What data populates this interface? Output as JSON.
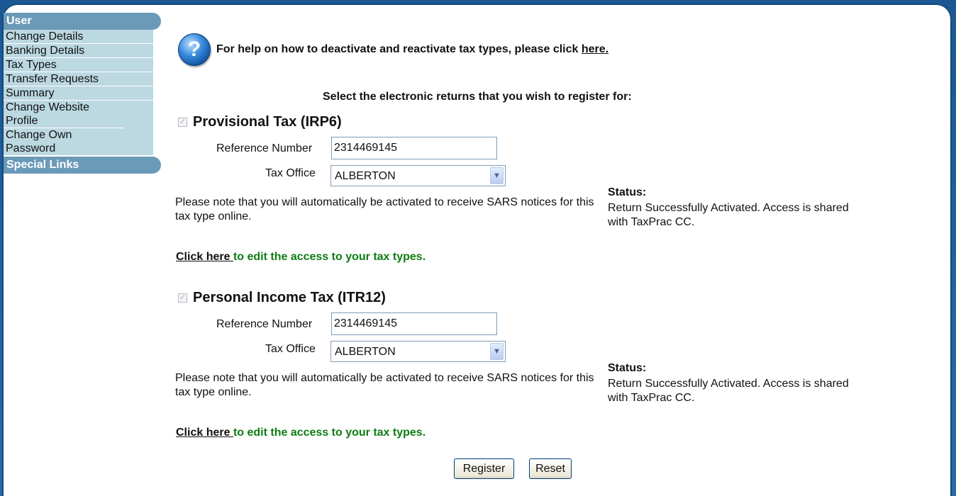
{
  "sidebar": {
    "user_heading": "User",
    "items": [
      {
        "label": "Change Details"
      },
      {
        "label": "Banking Details"
      },
      {
        "label": "Tax Types"
      },
      {
        "label": "Transfer Requests"
      },
      {
        "label": "Summary"
      },
      {
        "label": "Change Website Profile"
      },
      {
        "label": "Change Own Password"
      }
    ],
    "special_heading": "Special Links"
  },
  "help": {
    "icon": "question-icon",
    "text": "For help on how to deactivate and reactivate tax types, please click ",
    "link": "here."
  },
  "select_title": "Select the electronic returns that you wish to register for:",
  "tax_types": [
    {
      "title": "Provisional Tax (IRP6)",
      "checked": true,
      "ref_label": "Reference Number",
      "ref_value": "2314469145",
      "office_label": "Tax Office",
      "office_value": "ALBERTON",
      "note": "Please note that you will automatically be activated to receive SARS notices for this tax type online.",
      "status_label": "Status:",
      "status_text": "Return Successfully Activated. Access is shared with TaxPrac CC.",
      "click_link": "Click here ",
      "click_text": "to edit the access to your tax types."
    },
    {
      "title": "Personal Income Tax (ITR12)",
      "checked": true,
      "ref_label": "Reference Number",
      "ref_value": "2314469145",
      "office_label": "Tax Office",
      "office_value": "ALBERTON",
      "note": "Please note that you will automatically be activated to receive SARS notices for this tax type online.",
      "status_label": "Status:",
      "status_text": "Return Successfully Activated. Access is shared with TaxPrac CC.",
      "click_link": "Click here ",
      "click_text": "to edit the access to your tax types."
    }
  ],
  "buttons": {
    "register": "Register",
    "reset": "Reset"
  },
  "colors": {
    "frame": "#1d5a96",
    "sidebar_heading": "#6b9ab8",
    "sidebar_items": "#bcd8e1",
    "green_link": "#0d7d12"
  }
}
